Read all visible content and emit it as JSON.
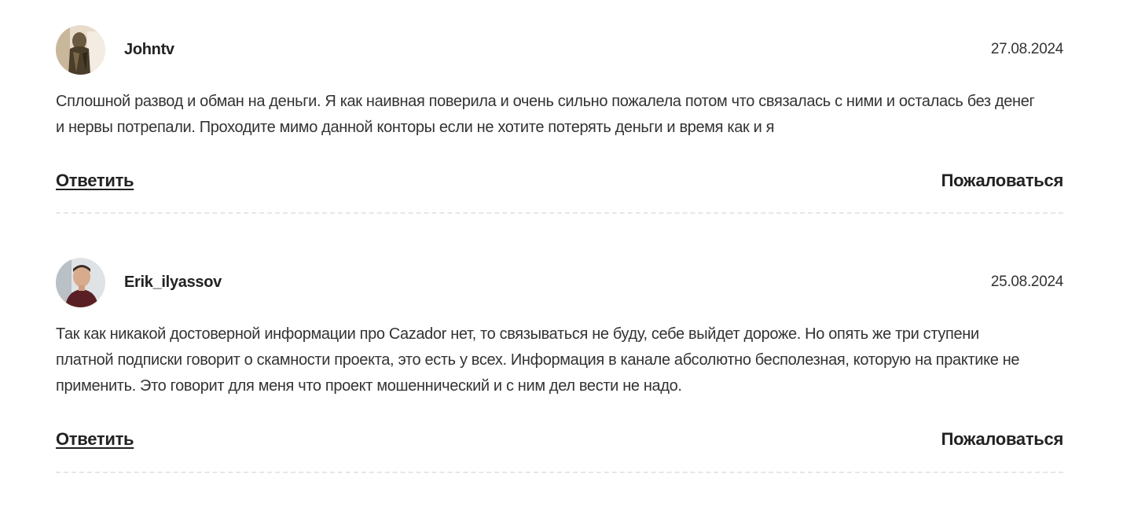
{
  "comments": [
    {
      "username": "Johntv",
      "date": "27.08.2024",
      "avatar_icon": "user-photo-avatar",
      "text": "Сплошной развод и обман на деньги. Я как наивная поверила и очень сильно пожалела потом что связалась с ними и осталась без денег и нервы потрепали. Проходите мимо данной конторы если не хотите потерять деньги и время как и я",
      "reply_label": "Ответить",
      "complain_label": "Пожаловаться"
    },
    {
      "username": "Erik_ilyassov",
      "date": "25.08.2024",
      "avatar_icon": "user-photo-avatar",
      "text": "Так как никакой достоверной информации про Cazador нет, то связываться не буду, себе выйдет дороже. Но опять же три ступени платной подписки говорит о скамности проекта, это есть у всех. Информация в канале абсолютно бесполезная, которую на практике не применить. Это говорит для меня что проект мошеннический и с ним дел вести не надо.",
      "reply_label": "Ответить",
      "complain_label": "Пожаловаться"
    }
  ]
}
